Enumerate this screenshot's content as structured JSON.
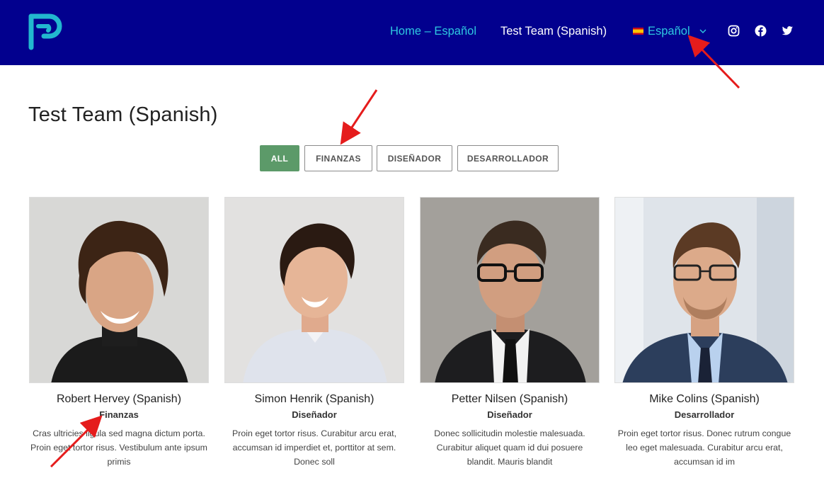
{
  "nav": {
    "home": "Home – Español",
    "team": "Test Team (Spanish)",
    "language": "Español"
  },
  "page": {
    "title": "Test Team (Spanish)"
  },
  "filters": [
    "ALL",
    "FINANZAS",
    "DISEÑADOR",
    "DESARROLLADOR"
  ],
  "members": [
    {
      "name": "Robert Hervey (Spanish)",
      "role": "Finanzas",
      "description": "Cras ultricies ligula sed magna dictum porta. Proin eget tortor risus. Vestibulum ante ipsum primis"
    },
    {
      "name": "Simon Henrik (Spanish)",
      "role": "Diseñador",
      "description": "Proin eget tortor risus. Curabitur arcu erat, accumsan id imperdiet et, porttitor at sem. Donec soll"
    },
    {
      "name": "Petter Nilsen (Spanish)",
      "role": "Diseñador",
      "description": "Donec sollicitudin molestie malesuada. Curabitur aliquet quam id dui posuere blandit. Mauris blandit"
    },
    {
      "name": "Mike Colins (Spanish)",
      "role": "Desarrollador",
      "description": "Proin eget tortor risus. Donec rutrum congue leo eget malesuada. Curabitur arcu erat, accumsan id im"
    }
  ],
  "colors": {
    "header_bg": "#02008e",
    "accent_cyan": "#2ec8e0",
    "active_filter": "#5c9a69",
    "annotation_red": "#e51c1c"
  },
  "icons": [
    "logo-icon",
    "spain-flag-icon",
    "chevron-down-icon",
    "instagram-icon",
    "facebook-icon",
    "twitter-icon",
    "annotation-arrow-icon"
  ]
}
